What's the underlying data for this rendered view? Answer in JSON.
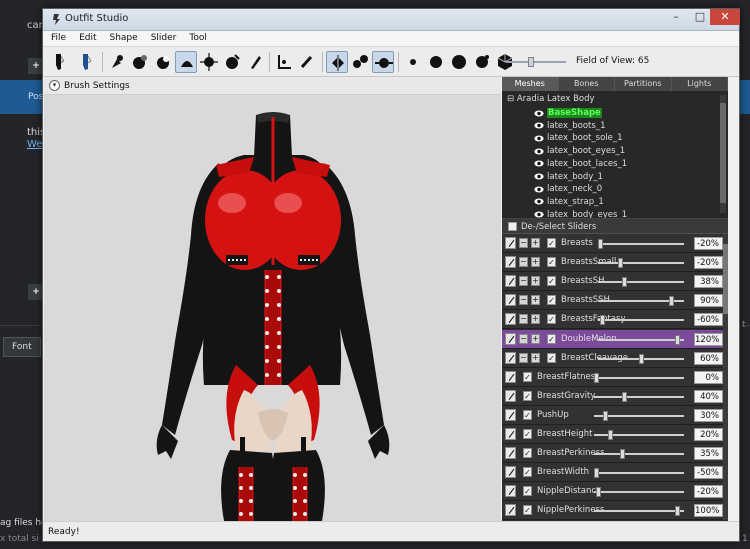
{
  "background_page": {
    "top_text": "can",
    "plus": "+",
    "bar_text": "Pos",
    "text_line": "this",
    "link_text": "We",
    "font_button": "Font",
    "bottom_text_1": "ag files here",
    "bottom_text_2": "x total si",
    "right_text_1": "t",
    "right_text_2": "1"
  },
  "window": {
    "title": "Outfit Studio",
    "min_glyph": "–",
    "max_glyph": "□",
    "close_glyph": "✕"
  },
  "menu": [
    "File",
    "Edit",
    "Shape",
    "Slider",
    "Tool"
  ],
  "toolbar": {
    "field_of_view_label": "Field of View: 65",
    "field_of_view": 65,
    "field_of_view_fraction": 0.4
  },
  "brush_settings": {
    "label": "Brush Settings"
  },
  "tabs": [
    "Meshes",
    "Bones",
    "Partitions",
    "Lights"
  ],
  "active_tab": "Meshes",
  "mesh_tree": {
    "root": "Aradia Latex Body",
    "expand_glyph": "⊟",
    "items": [
      {
        "label": "BaseShape",
        "selected": true
      },
      {
        "label": "latex_boots_1",
        "selected": false
      },
      {
        "label": "latex_boot_sole_1",
        "selected": false
      },
      {
        "label": "latex_boot_eyes_1",
        "selected": false
      },
      {
        "label": "latex_boot_laces_1",
        "selected": false
      },
      {
        "label": "latex_body_1",
        "selected": false
      },
      {
        "label": "latex_neck_0",
        "selected": false
      },
      {
        "label": "latex_strap_1",
        "selected": false
      },
      {
        "label": "latex_body_eyes_1",
        "selected": false
      }
    ]
  },
  "sliders_header": {
    "label": "De-/Select Sliders"
  },
  "sliders": [
    {
      "name": "Breasts",
      "value": "-20%",
      "pos": 0.0,
      "pm": true,
      "highlight": false
    },
    {
      "name": "BreastsSmall",
      "value": "-20%",
      "pos": 0.25,
      "pm": true,
      "highlight": false
    },
    {
      "name": "BreastsSH",
      "value": "38%",
      "pos": 0.3,
      "pm": true,
      "highlight": false
    },
    {
      "name": "BreastsSSH",
      "value": "90%",
      "pos": 0.88,
      "pm": true,
      "highlight": false
    },
    {
      "name": "BreastsFantasy",
      "value": "-60%",
      "pos": 0.02,
      "pm": true,
      "highlight": false
    },
    {
      "name": "DoubleMelon",
      "value": "120%",
      "pos": 0.95,
      "pm": true,
      "highlight": true
    },
    {
      "name": "BreastCleavage",
      "value": "60%",
      "pos": 0.5,
      "pm": true,
      "highlight": false
    },
    {
      "name": "BreastFlatness",
      "value": "0%",
      "pos": 0.0,
      "pm": false,
      "highlight": false
    },
    {
      "name": "BreastGravity",
      "value": "40%",
      "pos": 0.33,
      "pm": false,
      "highlight": false
    },
    {
      "name": "PushUp",
      "value": "30%",
      "pos": 0.1,
      "pm": false,
      "highlight": false
    },
    {
      "name": "BreastHeight",
      "value": "20%",
      "pos": 0.16,
      "pm": false,
      "highlight": false
    },
    {
      "name": "BreastPerkiness",
      "value": "35%",
      "pos": 0.31,
      "pm": false,
      "highlight": false
    },
    {
      "name": "BreastWidth",
      "value": "-50%",
      "pos": 0.0,
      "pm": false,
      "highlight": false
    },
    {
      "name": "NippleDistance",
      "value": "-20%",
      "pos": 0.02,
      "pm": false,
      "highlight": false
    },
    {
      "name": "NipplePerkiness",
      "value": "100%",
      "pos": 0.95,
      "pm": false,
      "highlight": false
    }
  ],
  "status": {
    "text": "Ready!"
  },
  "colors": {
    "panel_dark": "#2d2d2d",
    "slider_highlight": "#7c4a9a",
    "selected_mesh": "#5dff5d",
    "latex_red": "#d41212",
    "latex_black": "#141414"
  }
}
